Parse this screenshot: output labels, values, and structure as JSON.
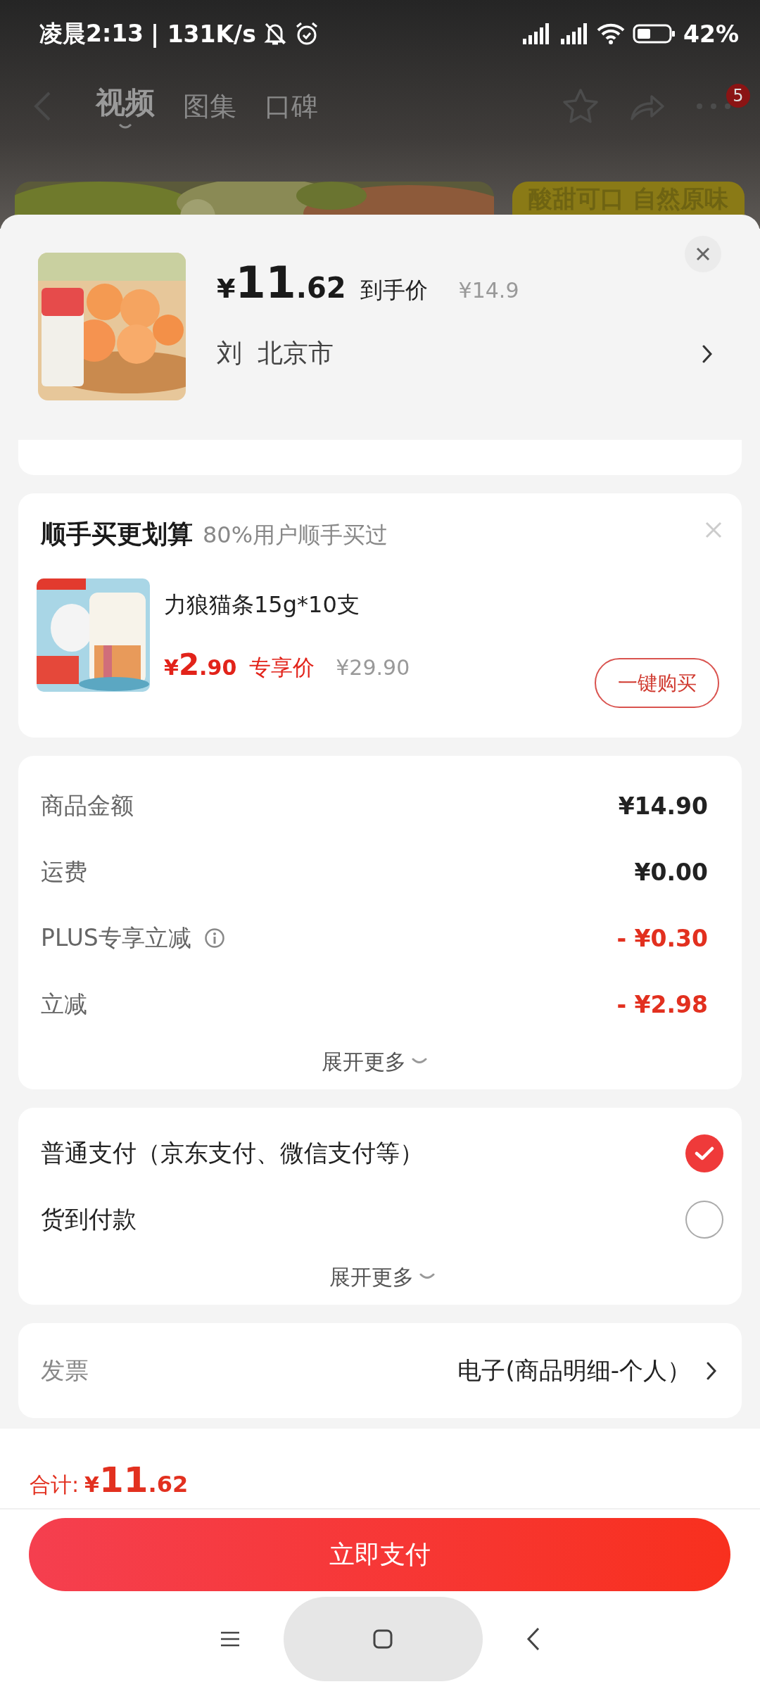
{
  "status_bar": {
    "time": "凌晨2:13",
    "speed": "| 131K/s",
    "battery": "42%"
  },
  "top_nav": {
    "tabs": [
      {
        "label": "视频",
        "selected": true
      },
      {
        "label": "图集",
        "selected": false
      },
      {
        "label": "口碑",
        "selected": false
      }
    ],
    "more_badge": "5"
  },
  "banner": {
    "caption": "酸甜可口 自然原味"
  },
  "product": {
    "price": "¥11.62",
    "price_label": "到手价",
    "original_price": "¥14.9",
    "recipient": "刘",
    "city": "北京市"
  },
  "addon": {
    "title": "顺手买更划算",
    "subtitle": "80%用户顺手买过",
    "item": {
      "name": "力狼猫条15g*10支",
      "price": "¥2.90",
      "price_label": "专享价",
      "original_price": "¥29.90",
      "buy_button": "一键购买"
    }
  },
  "amounts": {
    "rows": [
      {
        "label": "商品金额",
        "value": "¥14.90",
        "kind": "plain",
        "info": false
      },
      {
        "label": "运费",
        "value": "¥0.00",
        "kind": "plain",
        "info": false
      },
      {
        "label": "PLUS专享立减",
        "value": "- ¥0.30",
        "kind": "discount",
        "info": true
      },
      {
        "label": "立减",
        "value": "- ¥2.98",
        "kind": "discount",
        "info": false
      }
    ],
    "expand": "展开更多"
  },
  "payment": {
    "options": [
      {
        "label": "普通支付（京东支付、微信支付等）",
        "selected": true
      },
      {
        "label": "货到付款",
        "selected": false
      }
    ],
    "expand": "展开更多"
  },
  "invoice": {
    "label": "发票",
    "value": "电子(商品明细-个人）"
  },
  "footer": {
    "total_label": "合计:",
    "total": "¥11.62",
    "pay_button": "立即支付"
  }
}
